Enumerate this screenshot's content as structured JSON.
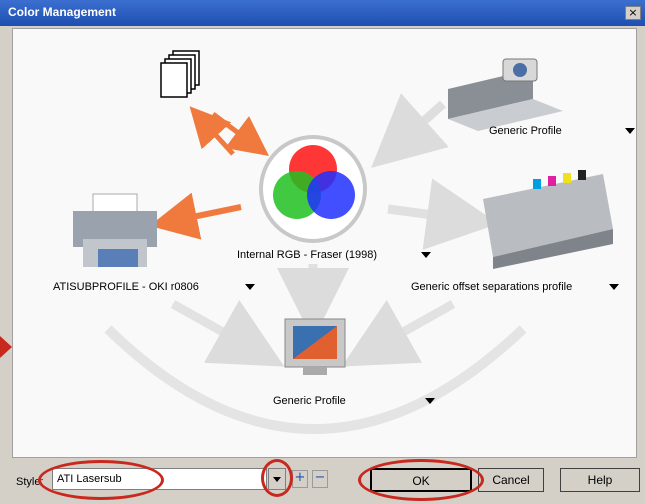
{
  "window": {
    "title": "Color Management",
    "close_glyph": "×"
  },
  "devices": {
    "scanner": {
      "label": "Generic Profile",
      "icon": "scanner-camera-icon"
    },
    "center": {
      "label": "Internal RGB - Fraser (1998)",
      "icon": "rgb-color-wheel-icon"
    },
    "printer": {
      "label": "ATISUBPROFILE - OKI r0806",
      "icon": "desktop-printer-icon"
    },
    "press": {
      "label": "Generic offset separations profile",
      "icon": "offset-press-icon"
    },
    "monitor": {
      "label": "Generic Profile",
      "icon": "monitor-icon"
    },
    "documents": {
      "icon": "documents-icon"
    }
  },
  "footer": {
    "style_label": "Style:",
    "style_value": "ATI Lasersub",
    "add_glyph": "+",
    "remove_glyph": "−",
    "ok_label": "OK",
    "cancel_label": "Cancel",
    "help_label": "Help"
  },
  "colors": {
    "accent_arrow": "#f07a3e",
    "annotation": "#c8281e",
    "title_bar": "#1e4fb0"
  }
}
